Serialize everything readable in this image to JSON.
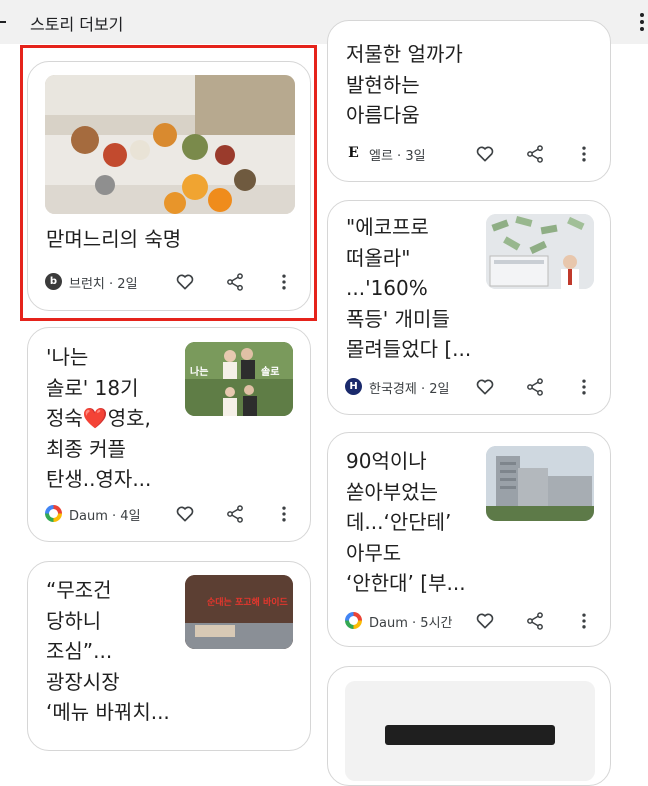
{
  "header": {
    "title": "스토리 더보기"
  },
  "cards": {
    "c0": {
      "title": "맏며느리의 숙명",
      "source": "브런치",
      "time": "2일"
    },
    "c1": {
      "title": "'나는\n솔로' 18기\n정숙❤️영호,\n최종 커플\n탄생..영자...",
      "source": "Daum",
      "time": "4일"
    },
    "c2": {
      "title": "“무조건\n당하니\n조심”...\n광장시장\n‘메뉴 바꿔치...",
      "source": "",
      "time": ""
    },
    "c3": {
      "title": "저물한 얼까가\n발현하는\n아름다움",
      "source": "엘르",
      "time": "3일"
    },
    "c4": {
      "title": "\"에코프로\n떠올라\"\n...'160%\n폭등' 개미들\n몰려들었다 [...",
      "source": "한국경제",
      "time": "2일"
    },
    "c5": {
      "title": "90억이나\n쏟아부었는\n데...‘안단테’\n아무도\n‘안한대’ [부...",
      "source": "Daum",
      "time": "5시간"
    }
  },
  "thumb_text": {
    "c1_left": "나는",
    "c1_right": "솔로",
    "c2_overlay": "순대는 포고해\n바이드"
  },
  "colors": {
    "highlight": "#e5231b",
    "hankyung": "#1a2a6c",
    "brunch": "#3b3b3b"
  }
}
